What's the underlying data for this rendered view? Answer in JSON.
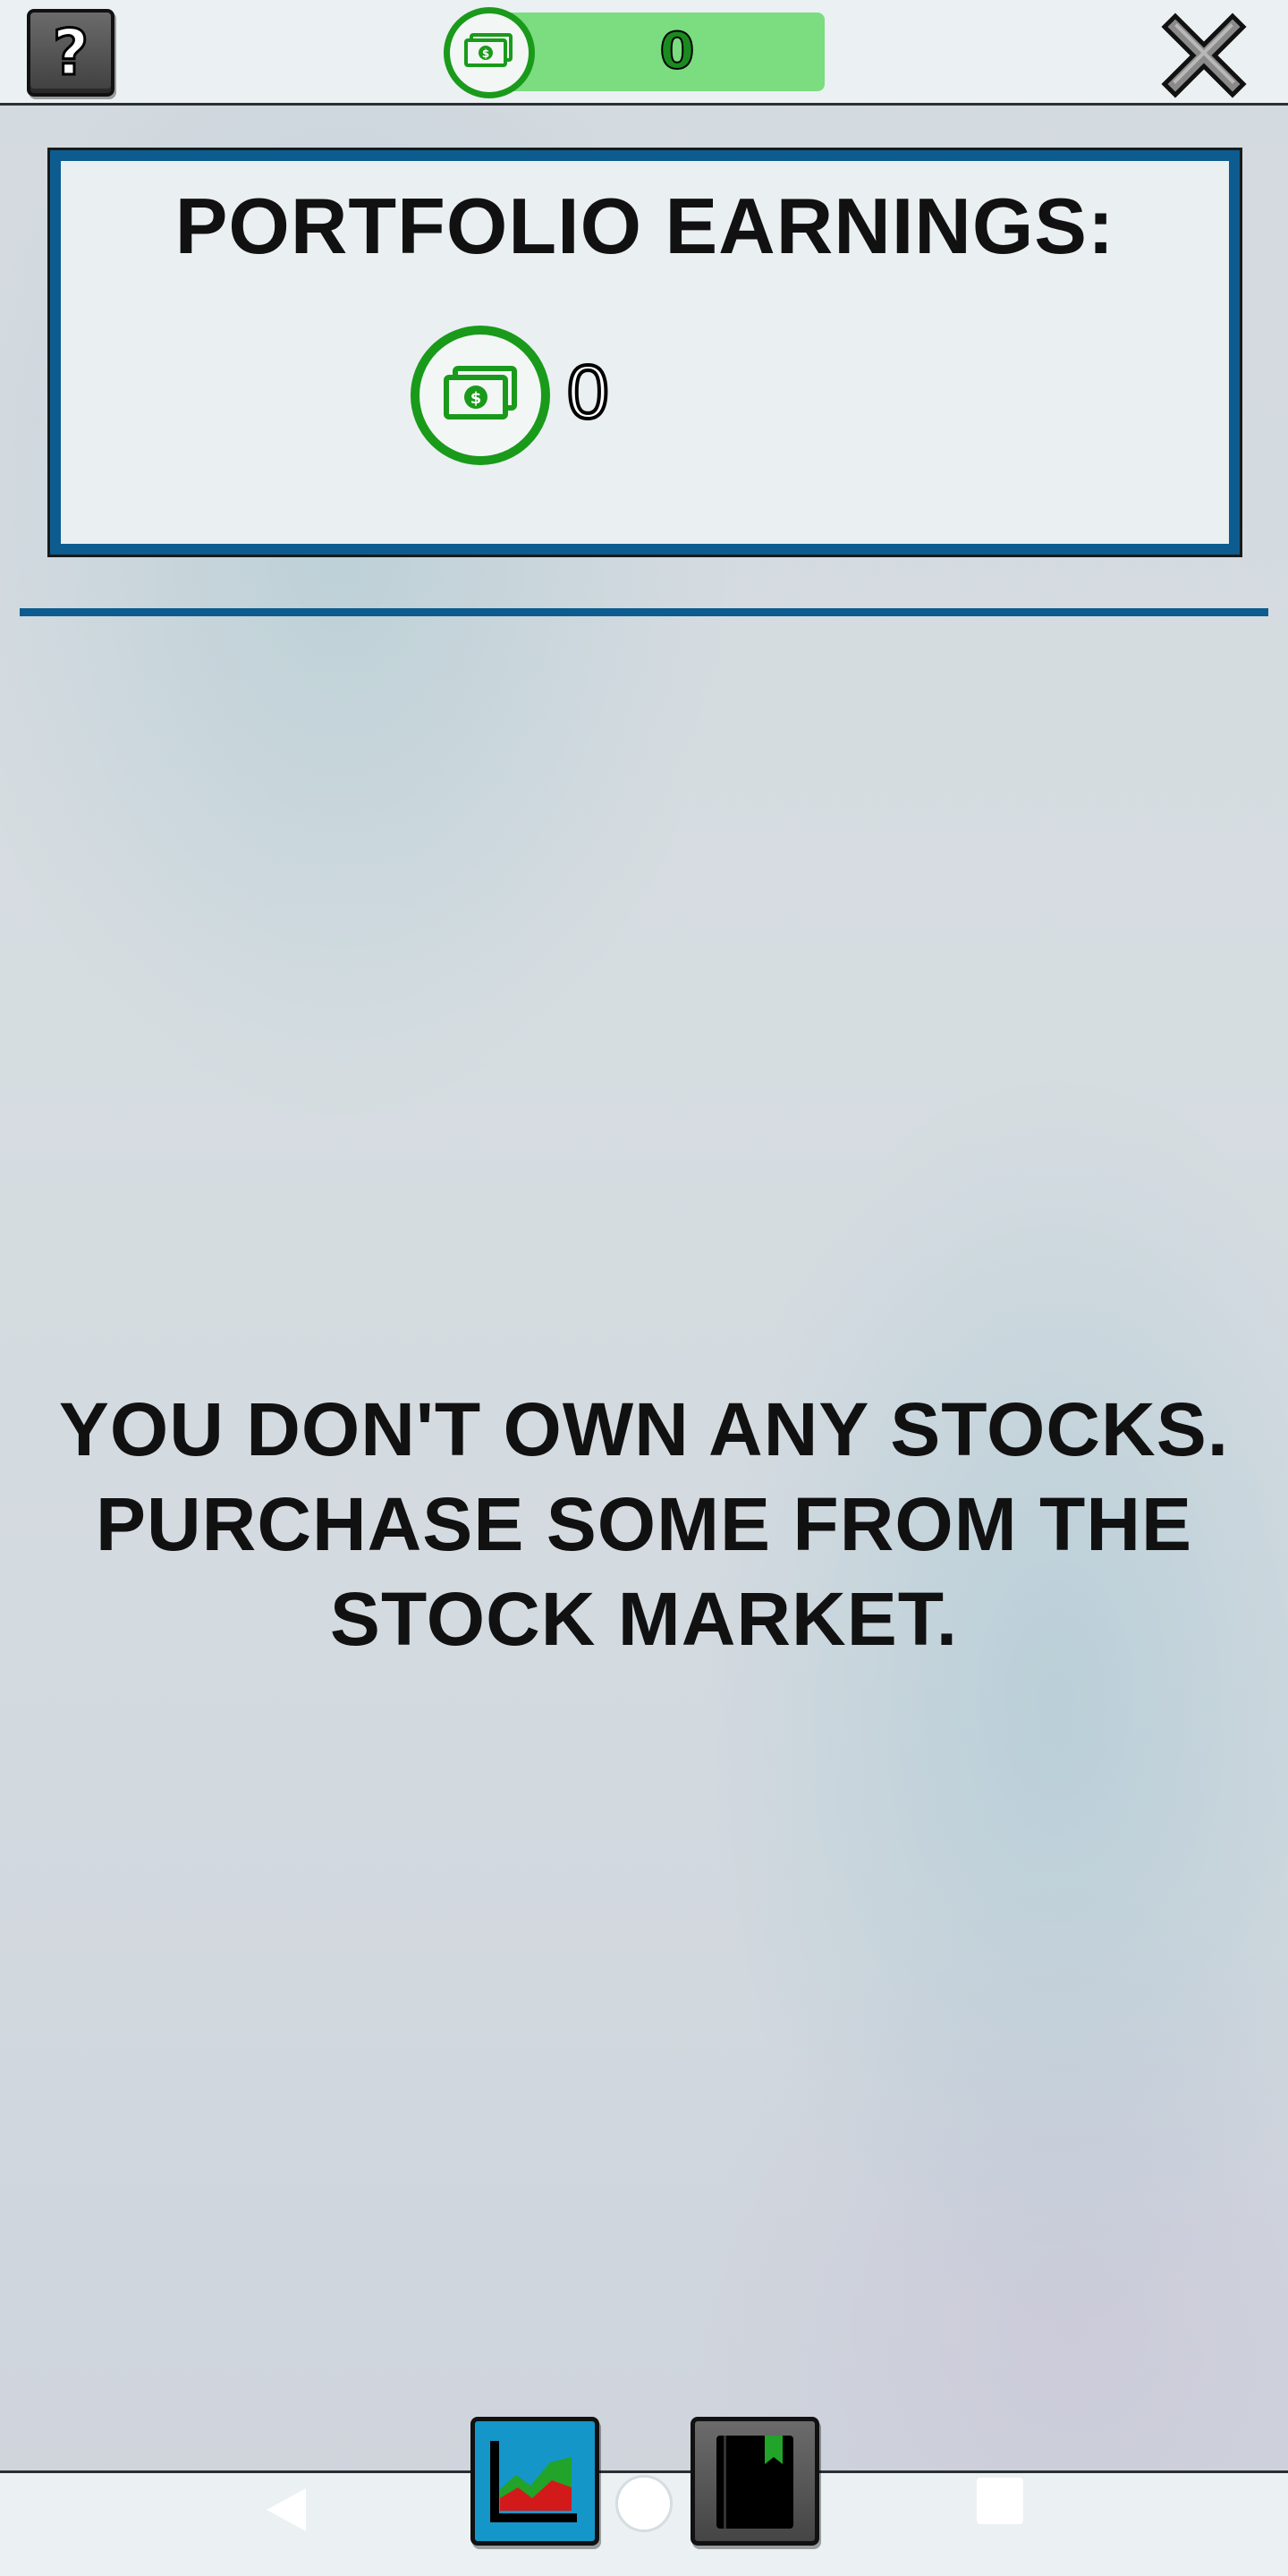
{
  "topbar": {
    "help_label": "?",
    "balance_value": "0",
    "balance_icon": "cash-icon",
    "close_icon": "close-icon"
  },
  "earnings": {
    "title": "PORTFOLIO EARNINGS:",
    "value": "0",
    "icon": "cash-icon"
  },
  "empty_state": {
    "line1": "YOU DON'T OWN ANY STOCKS.",
    "line2": "PURCHASE SOME FROM THE",
    "line3": "STOCK MARKET."
  },
  "tabs": [
    {
      "icon": "stock-chart-icon"
    },
    {
      "icon": "journal-bookmark-icon"
    }
  ],
  "system_nav": {
    "back_icon": "back-icon",
    "home_icon": "home-icon",
    "recents_icon": "recents-icon"
  },
  "colors": {
    "accent_blue": "#0d5c8f",
    "cash_green": "#1a9a1a",
    "balance_bar": "#7bdc80",
    "tab_stocks_bg": "#1596c9"
  }
}
